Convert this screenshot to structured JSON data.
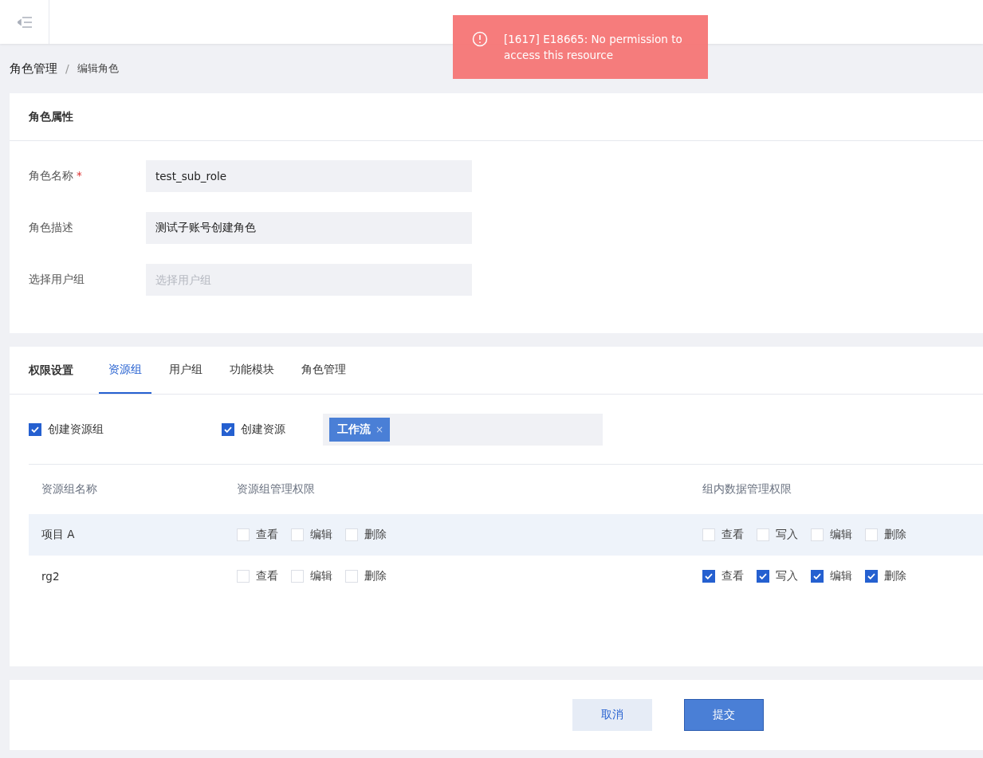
{
  "topbar": {
    "toast": {
      "message": "[1617] E18665: No permission to access this resource"
    }
  },
  "breadcrumb": {
    "items": [
      {
        "label": "角色管理",
        "current": false
      },
      {
        "label": "编辑角色",
        "current": true
      }
    ],
    "separator": "/"
  },
  "role_properties": {
    "title": "角色属性",
    "fields": [
      {
        "label": "角色名称",
        "required_mark": "*",
        "value": "test_sub_role"
      },
      {
        "label": "角色描述",
        "value": "测试子账号创建角色"
      },
      {
        "label": "选择用户组",
        "placeholder": "选择用户组"
      }
    ]
  },
  "permissions": {
    "title": "权限设置",
    "tabs": [
      {
        "label": "资源组",
        "selected": true
      },
      {
        "label": "用户组",
        "selected": false
      },
      {
        "label": "功能模块",
        "selected": false
      },
      {
        "label": "角色管理",
        "selected": false
      }
    ],
    "options": [
      {
        "label": "创建资源组",
        "checked": true
      },
      {
        "label": "创建资源",
        "checked": true,
        "tags": [
          {
            "label": "工作流",
            "remove": "×"
          }
        ]
      }
    ],
    "table": {
      "columns": [
        "资源组名称",
        "资源组管理权限",
        "组内数据管理权限"
      ],
      "rows": [
        {
          "name": "项目 A",
          "highlighted": true,
          "group_permissions": [
            {
              "label": "查看",
              "checked": false
            },
            {
              "label": "编辑",
              "checked": false
            },
            {
              "label": "删除",
              "checked": false
            }
          ],
          "data_permissions": [
            {
              "label": "查看",
              "checked": false
            },
            {
              "label": "写入",
              "checked": false
            },
            {
              "label": "编辑",
              "checked": false
            },
            {
              "label": "删除",
              "checked": false
            }
          ]
        },
        {
          "name": "rg2",
          "highlighted": false,
          "group_permissions": [
            {
              "label": "查看",
              "checked": false
            },
            {
              "label": "编辑",
              "checked": false
            },
            {
              "label": "删除",
              "checked": false
            }
          ],
          "data_permissions": [
            {
              "label": "查看",
              "checked": true
            },
            {
              "label": "写入",
              "checked": true
            },
            {
              "label": "编辑",
              "checked": true
            },
            {
              "label": "删除",
              "checked": true
            }
          ]
        }
      ]
    }
  },
  "actions": [
    {
      "label": "取消",
      "kind": "secondary"
    },
    {
      "label": "提交",
      "kind": "primary"
    }
  ]
}
